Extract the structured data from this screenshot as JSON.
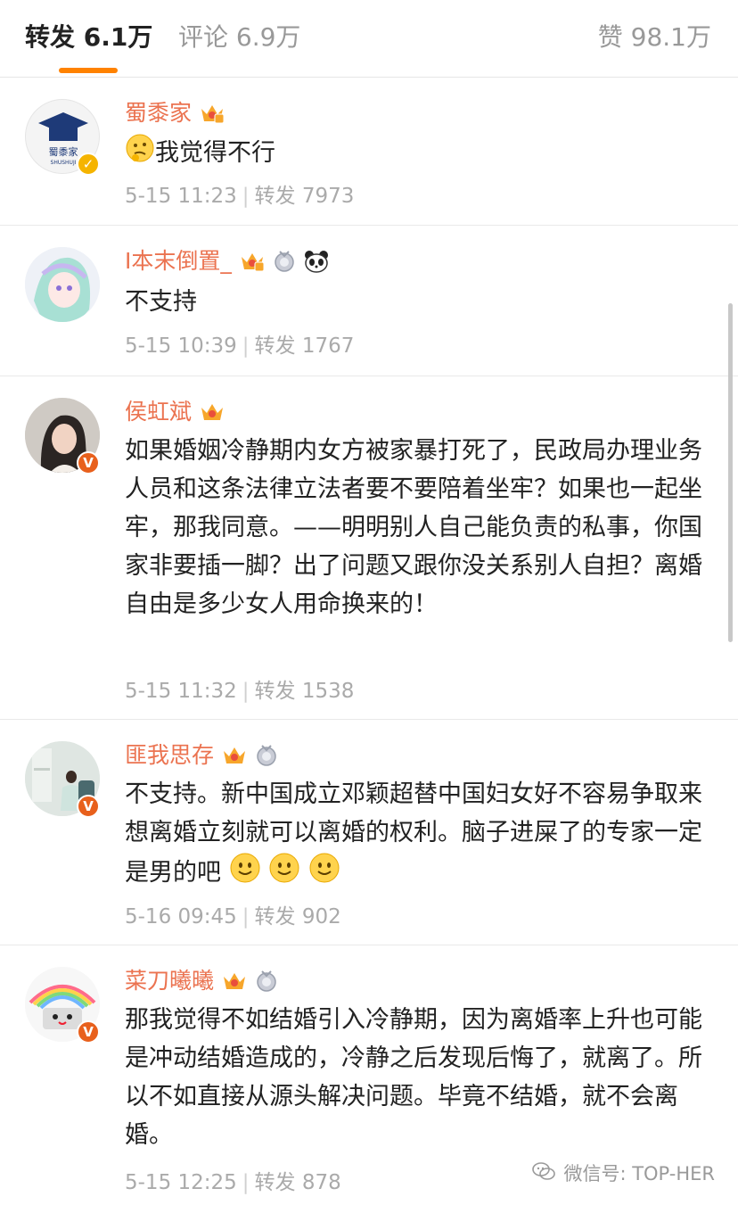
{
  "tabs": {
    "repost": "转发 6.1万",
    "comment": "评论 6.9万",
    "like": "赞 98.1万"
  },
  "comments": [
    {
      "name": "蜀黍家",
      "text": "我觉得不行",
      "time": "5-15 11:23",
      "repost": "转发 7973",
      "avatar_text": "蜀黍家",
      "avatar_sub": "SHUSHUJI"
    },
    {
      "name": "I本末倒置_",
      "text": "不支持",
      "time": "5-15 10:39",
      "repost": "转发 1767"
    },
    {
      "name": "侯虹斌",
      "text": "如果婚姻冷静期内女方被家暴打死了，民政局办理业务人员和这条法律立法者要不要陪着坐牢？如果也一起坐牢，那我同意。——明明别人自己能负责的私事，你国家非要插一脚？出了问题又跟你没关系别人自担？离婚自由是多少女人用命换来的！",
      "time": "5-15 11:32",
      "repost": "转发 1538"
    },
    {
      "name": "匪我思存",
      "text": "不支持。新中国成立邓颖超替中国妇女好不容易争取来想离婚立刻就可以离婚的权利。脑子进屎了的专家一定是男的吧",
      "time": "5-16 09:45",
      "repost": "转发 902"
    },
    {
      "name": "菜刀曦曦",
      "text": "那我觉得不如结婚引入冷静期，因为离婚率上升也可能是冲动结婚造成的，冷静之后发现后悔了，就离了。所以不如直接从源头解决问题。毕竟不结婚，就不会离婚。",
      "time": "5-15 12:25",
      "repost": "转发 878"
    }
  ],
  "watermark": "微信号: TOP-HER",
  "colors": {
    "accent": "#ff8200",
    "username": "#eb7350",
    "meta": "#aaaaaa"
  },
  "icons": [
    "vip-crown-icon",
    "medal-icon",
    "panda-icon",
    "thinking-emoji-icon",
    "smile-emoji-icon",
    "verified-badge-icon",
    "wechat-icon"
  ]
}
